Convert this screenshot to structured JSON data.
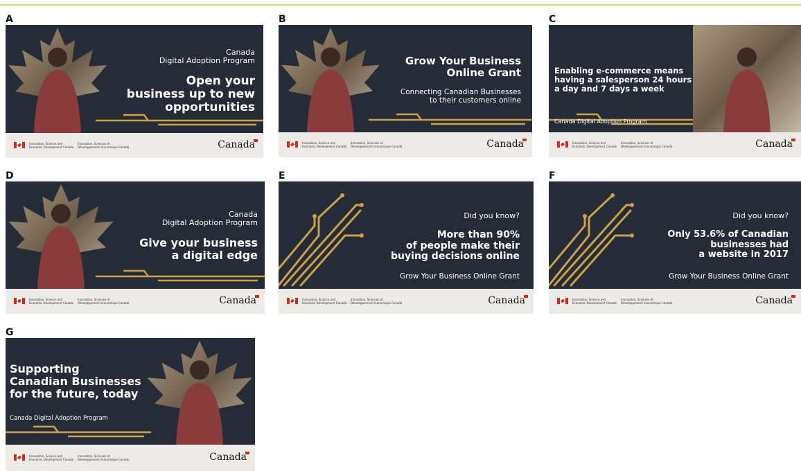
{
  "panels": [
    {
      "id": "A",
      "slug": "a",
      "kind": "photo",
      "lines": [
        {
          "text": "Canada\nDigital Adoption Program",
          "cls": "r"
        },
        {
          "text": "Open your\nbusiness up to new\nopportunities",
          "cls": "bold r"
        }
      ],
      "footer": {
        "dept_en": "Innovation, Science and\nEconomic Development Canada",
        "dept_fr": "Innovation, Sciences et\nDéveloppement économique Canada",
        "wordmark": "Canada"
      }
    },
    {
      "id": "B",
      "slug": "b",
      "kind": "photo",
      "lines": [
        {
          "text": "Grow Your Business\nOnline Grant",
          "cls": "bold r"
        },
        {
          "text": "Connecting Canadian Businesses\nto their customers online",
          "cls": "r"
        }
      ],
      "footer": {
        "dept_en": "Innovation, Science and\nEconomic Development Canada",
        "dept_fr": "Innovation, Sciences et\nDéveloppement économique Canada",
        "wordmark": "Canada"
      }
    },
    {
      "id": "C",
      "slug": "c",
      "kind": "photo",
      "lines": [
        {
          "text": "Enabling e-commerce means\nhaving a salesperson 24 hours\na day and 7 days a week",
          "cls": "bold"
        },
        {
          "text": "Canada Digital Adoption Program",
          "cls": ""
        }
      ],
      "footer": {
        "dept_en": "Innovation, Science and\nEconomic Development Canada",
        "dept_fr": "Innovation, Sciences et\nDéveloppement économique Canada",
        "wordmark": "Canada"
      }
    },
    {
      "id": "D",
      "slug": "d",
      "kind": "photo",
      "lines": [
        {
          "text": "Canada\nDigital Adoption Program",
          "cls": "r"
        },
        {
          "text": "Give your business\na digital edge",
          "cls": "bold r"
        }
      ],
      "footer": {
        "dept_en": "Innovation, Science and\nEconomic Development Canada",
        "dept_fr": "Innovation, Sciences et\nDéveloppement économique Canada",
        "wordmark": "Canada"
      }
    },
    {
      "id": "E",
      "slug": "e",
      "kind": "circuit",
      "lines": [
        {
          "text": "Did you know?",
          "cls": "r"
        },
        {
          "text": "More than 90%\nof people make their\nbuying decisions  online",
          "cls": "bold r"
        },
        {
          "text": "Grow Your Business Online Grant",
          "cls": "r"
        }
      ],
      "footer": {
        "dept_en": "Innovation, Science and\nEconomic Development Canada",
        "dept_fr": "Innovation, Sciences et\nDéveloppement économique Canada",
        "wordmark": "Canada"
      }
    },
    {
      "id": "F",
      "slug": "f",
      "kind": "circuit",
      "lines": [
        {
          "text": "Did you know?",
          "cls": "r"
        },
        {
          "text": "Only 53.6% of Canadian\nbusinesses had\na website in 2017",
          "cls": "bold r"
        },
        {
          "text": "Grow Your Business Online Grant",
          "cls": "r"
        }
      ],
      "footer": {
        "dept_en": "Innovation, Science and\nEconomic Development Canada",
        "dept_fr": "Innovation, Sciences et\nDéveloppement économique Canada",
        "wordmark": "Canada"
      }
    },
    {
      "id": "G",
      "slug": "g",
      "kind": "photo",
      "lines": [
        {
          "text": "Supporting\nCanadian Businesses\nfor the future, today",
          "cls": "bold"
        },
        {
          "text": "Canada Digital Adoption Program",
          "cls": ""
        }
      ],
      "footer": {
        "dept_en": "Innovation, Science and\nEconomic Development Canada",
        "dept_fr": "Innovation, Sciences et\nDéveloppement économique Canada",
        "wordmark": "Canada"
      }
    }
  ],
  "colors": {
    "banner_bg": "#262b38",
    "gold": "#c9a24a",
    "footer_bg": "#ecebe8",
    "flag_red": "#d52b1e",
    "border": "#d8dc5a"
  }
}
